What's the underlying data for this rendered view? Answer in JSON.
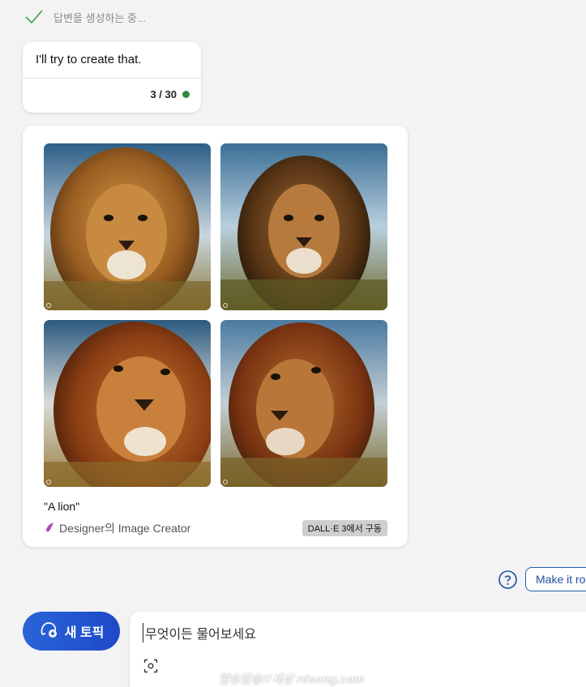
{
  "status": {
    "text": "답변을 생성하는 중...",
    "icon": "check-icon"
  },
  "message": {
    "text": "I'll try to create that.",
    "counter": "3 / 30",
    "counter_dot_color": "#2f8a3e"
  },
  "image_result": {
    "images": [
      {
        "name": "lion-image-1",
        "palette": "golden mane, blue sky"
      },
      {
        "name": "lion-image-2",
        "palette": "dark mane, cloudy sky"
      },
      {
        "name": "lion-image-3",
        "palette": "red mane, clouds"
      },
      {
        "name": "lion-image-4",
        "palette": "red mane, grass"
      }
    ],
    "prompt": "\"A lion\"",
    "creator": "Designer의 Image Creator",
    "badge": "DALL·E 3에서 구동"
  },
  "suggestions": {
    "help_icon": "question-icon",
    "chip": "Make it ro"
  },
  "composer": {
    "new_topic_label": "새 토픽",
    "placeholder": "무엇이든 물어보세요",
    "scan_icon": "image-scan-icon"
  },
  "watermark": "알송달송IT세상 rdsong.com",
  "colors": {
    "accent": "#1e49c9",
    "chip_border": "#1f5fa8"
  }
}
